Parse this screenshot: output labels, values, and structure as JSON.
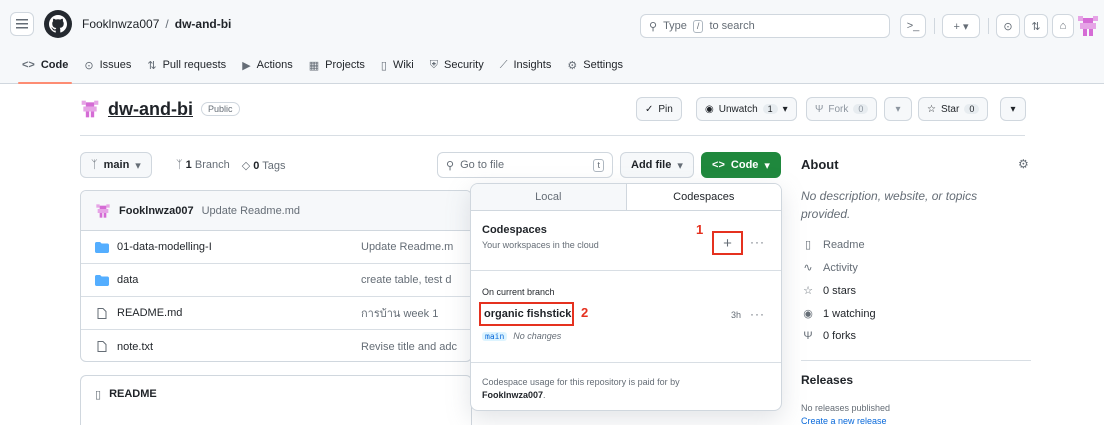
{
  "header": {
    "owner": "Fooklnwza007",
    "slash": "/",
    "repo": "dw-and-bi",
    "search_placeholder": "Type",
    "search_key": "/",
    "search_suffix": "to search",
    "terminal": ">_",
    "plus": "+ ▾",
    "circle": "⊙",
    "pr": "⇅",
    "inbox": "⌂"
  },
  "nav": {
    "items": [
      {
        "icon": "<>",
        "label": "Code"
      },
      {
        "icon": "⊙",
        "label": "Issues"
      },
      {
        "icon": "⇅",
        "label": "Pull requests"
      },
      {
        "icon": "▶",
        "label": "Actions"
      },
      {
        "icon": "▦",
        "label": "Projects"
      },
      {
        "icon": "▯",
        "label": "Wiki"
      },
      {
        "icon": "⛨",
        "label": "Security"
      },
      {
        "icon": "⟋",
        "label": "Insights"
      },
      {
        "icon": "⚙",
        "label": "Settings"
      }
    ]
  },
  "title": {
    "repo": "dw-and-bi",
    "visibility": "Public",
    "pin": "Pin",
    "unwatch": "Unwatch",
    "unwatch_count": "1",
    "fork": "Fork",
    "fork_count": "0",
    "star": "Star",
    "star_count": "0"
  },
  "branch": {
    "name": "main",
    "branches_count": "1",
    "branches_label": "Branch",
    "tags_count": "0",
    "tags_label": "Tags",
    "goto_placeholder": "Go to file",
    "goto_key": "t",
    "add_file": "Add file",
    "code": "Code"
  },
  "commit": {
    "author": "Fooklnwza007",
    "message": "Update Readme.md"
  },
  "files": [
    {
      "type": "folder",
      "name": "01-data-modelling-I",
      "message": "Update Readme.m"
    },
    {
      "type": "folder",
      "name": "data",
      "message": "create table, test d"
    },
    {
      "type": "file",
      "name": "README.md",
      "message": "การบ้าน week 1"
    },
    {
      "type": "file",
      "name": "note.txt",
      "message": "Revise title and adc"
    }
  ],
  "readme": {
    "label": "README"
  },
  "dropdown": {
    "tab_local": "Local",
    "tab_codespaces": "Codespaces",
    "cs_title": "Codespaces",
    "cs_sub": "Your workspaces in the cloud",
    "annot_1": "1",
    "annot_2": "2",
    "plus": "+",
    "more": "···",
    "on_branch": "On current branch",
    "codespace_name": "organic fishstick",
    "codespace_branch": "main",
    "codespace_changes": "No changes",
    "codespace_time": "3h",
    "footer_prefix": "Codespace usage for this repository is paid for by",
    "footer_owner": "Fooklnwza007",
    "footer_suffix": "."
  },
  "about": {
    "title": "About",
    "description": "No description, website, or topics provided.",
    "readme": "Readme",
    "activity": "Activity",
    "stars": "0 stars",
    "watching": "1 watching",
    "forks": "0 forks"
  },
  "releases": {
    "title": "Releases",
    "none": "No releases published",
    "create": "Create a new release"
  }
}
